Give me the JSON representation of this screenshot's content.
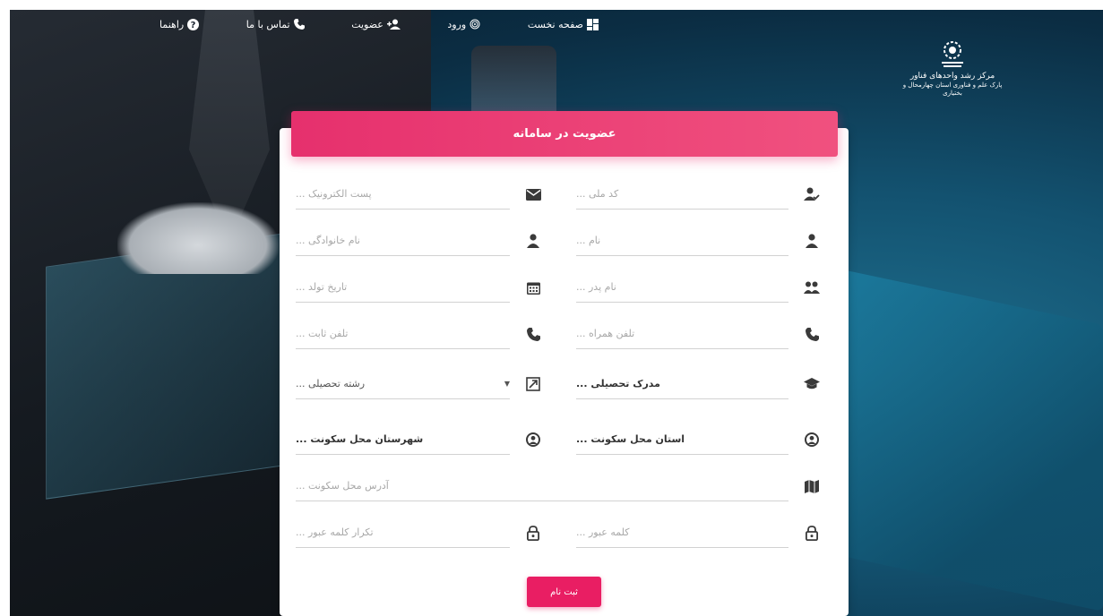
{
  "nav": {
    "items": [
      {
        "label": "صفحه نخست",
        "icon": "dashboard-icon"
      },
      {
        "label": "ورود",
        "icon": "fingerprint-icon"
      },
      {
        "label": "عضویت",
        "icon": "add-user-icon"
      },
      {
        "label": "تماس با ما",
        "icon": "phone-icon"
      },
      {
        "label": "راهنما",
        "icon": "help-icon"
      }
    ]
  },
  "logo": {
    "line1": "مرکز رشد واحدهای فناور",
    "line2": "پارک علم و فناوری استان چهارمحال و بختیاری"
  },
  "form": {
    "title": "عضویت در سامانه",
    "fields": {
      "national_code": "کد ملی ...",
      "email": "پست الکترونیک ...",
      "first_name": "نام ...",
      "last_name": "نام خانوادگی ...",
      "father_name": "نام پدر ...",
      "birth_date": "تاریخ تولد ...",
      "mobile": "تلفن همراه ...",
      "phone": "تلفن ثابت ...",
      "degree": "مدرک تحصیلی ...",
      "field_of_study": "رشته تحصیلی ...",
      "province": "استان محل سکونت ...",
      "city": "شهرستان محل سکونت ...",
      "address": "آدرس محل سکونت ...",
      "password": "کلمه عبور ...",
      "password_repeat": "تکرار کلمه عبور ..."
    },
    "submit": "ثبت نام"
  },
  "colors": {
    "accent": "#e91e63",
    "icon": "#3a3a3a"
  }
}
